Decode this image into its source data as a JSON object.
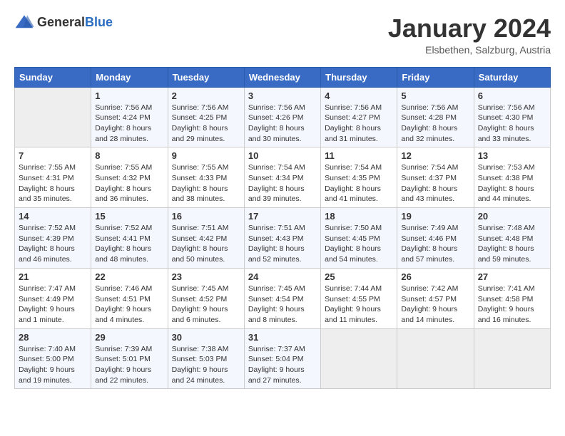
{
  "header": {
    "logo_general": "General",
    "logo_blue": "Blue",
    "month_title": "January 2024",
    "subtitle": "Elsbethen, Salzburg, Austria"
  },
  "days_of_week": [
    "Sunday",
    "Monday",
    "Tuesday",
    "Wednesday",
    "Thursday",
    "Friday",
    "Saturday"
  ],
  "weeks": [
    [
      {
        "day": "",
        "info": ""
      },
      {
        "day": "1",
        "info": "Sunrise: 7:56 AM\nSunset: 4:24 PM\nDaylight: 8 hours\nand 28 minutes."
      },
      {
        "day": "2",
        "info": "Sunrise: 7:56 AM\nSunset: 4:25 PM\nDaylight: 8 hours\nand 29 minutes."
      },
      {
        "day": "3",
        "info": "Sunrise: 7:56 AM\nSunset: 4:26 PM\nDaylight: 8 hours\nand 30 minutes."
      },
      {
        "day": "4",
        "info": "Sunrise: 7:56 AM\nSunset: 4:27 PM\nDaylight: 8 hours\nand 31 minutes."
      },
      {
        "day": "5",
        "info": "Sunrise: 7:56 AM\nSunset: 4:28 PM\nDaylight: 8 hours\nand 32 minutes."
      },
      {
        "day": "6",
        "info": "Sunrise: 7:56 AM\nSunset: 4:30 PM\nDaylight: 8 hours\nand 33 minutes."
      }
    ],
    [
      {
        "day": "7",
        "info": "Sunrise: 7:55 AM\nSunset: 4:31 PM\nDaylight: 8 hours\nand 35 minutes."
      },
      {
        "day": "8",
        "info": "Sunrise: 7:55 AM\nSunset: 4:32 PM\nDaylight: 8 hours\nand 36 minutes."
      },
      {
        "day": "9",
        "info": "Sunrise: 7:55 AM\nSunset: 4:33 PM\nDaylight: 8 hours\nand 38 minutes."
      },
      {
        "day": "10",
        "info": "Sunrise: 7:54 AM\nSunset: 4:34 PM\nDaylight: 8 hours\nand 39 minutes."
      },
      {
        "day": "11",
        "info": "Sunrise: 7:54 AM\nSunset: 4:35 PM\nDaylight: 8 hours\nand 41 minutes."
      },
      {
        "day": "12",
        "info": "Sunrise: 7:54 AM\nSunset: 4:37 PM\nDaylight: 8 hours\nand 43 minutes."
      },
      {
        "day": "13",
        "info": "Sunrise: 7:53 AM\nSunset: 4:38 PM\nDaylight: 8 hours\nand 44 minutes."
      }
    ],
    [
      {
        "day": "14",
        "info": "Sunrise: 7:52 AM\nSunset: 4:39 PM\nDaylight: 8 hours\nand 46 minutes."
      },
      {
        "day": "15",
        "info": "Sunrise: 7:52 AM\nSunset: 4:41 PM\nDaylight: 8 hours\nand 48 minutes."
      },
      {
        "day": "16",
        "info": "Sunrise: 7:51 AM\nSunset: 4:42 PM\nDaylight: 8 hours\nand 50 minutes."
      },
      {
        "day": "17",
        "info": "Sunrise: 7:51 AM\nSunset: 4:43 PM\nDaylight: 8 hours\nand 52 minutes."
      },
      {
        "day": "18",
        "info": "Sunrise: 7:50 AM\nSunset: 4:45 PM\nDaylight: 8 hours\nand 54 minutes."
      },
      {
        "day": "19",
        "info": "Sunrise: 7:49 AM\nSunset: 4:46 PM\nDaylight: 8 hours\nand 57 minutes."
      },
      {
        "day": "20",
        "info": "Sunrise: 7:48 AM\nSunset: 4:48 PM\nDaylight: 8 hours\nand 59 minutes."
      }
    ],
    [
      {
        "day": "21",
        "info": "Sunrise: 7:47 AM\nSunset: 4:49 PM\nDaylight: 9 hours\nand 1 minute."
      },
      {
        "day": "22",
        "info": "Sunrise: 7:46 AM\nSunset: 4:51 PM\nDaylight: 9 hours\nand 4 minutes."
      },
      {
        "day": "23",
        "info": "Sunrise: 7:45 AM\nSunset: 4:52 PM\nDaylight: 9 hours\nand 6 minutes."
      },
      {
        "day": "24",
        "info": "Sunrise: 7:45 AM\nSunset: 4:54 PM\nDaylight: 9 hours\nand 8 minutes."
      },
      {
        "day": "25",
        "info": "Sunrise: 7:44 AM\nSunset: 4:55 PM\nDaylight: 9 hours\nand 11 minutes."
      },
      {
        "day": "26",
        "info": "Sunrise: 7:42 AM\nSunset: 4:57 PM\nDaylight: 9 hours\nand 14 minutes."
      },
      {
        "day": "27",
        "info": "Sunrise: 7:41 AM\nSunset: 4:58 PM\nDaylight: 9 hours\nand 16 minutes."
      }
    ],
    [
      {
        "day": "28",
        "info": "Sunrise: 7:40 AM\nSunset: 5:00 PM\nDaylight: 9 hours\nand 19 minutes."
      },
      {
        "day": "29",
        "info": "Sunrise: 7:39 AM\nSunset: 5:01 PM\nDaylight: 9 hours\nand 22 minutes."
      },
      {
        "day": "30",
        "info": "Sunrise: 7:38 AM\nSunset: 5:03 PM\nDaylight: 9 hours\nand 24 minutes."
      },
      {
        "day": "31",
        "info": "Sunrise: 7:37 AM\nSunset: 5:04 PM\nDaylight: 9 hours\nand 27 minutes."
      },
      {
        "day": "",
        "info": ""
      },
      {
        "day": "",
        "info": ""
      },
      {
        "day": "",
        "info": ""
      }
    ]
  ]
}
